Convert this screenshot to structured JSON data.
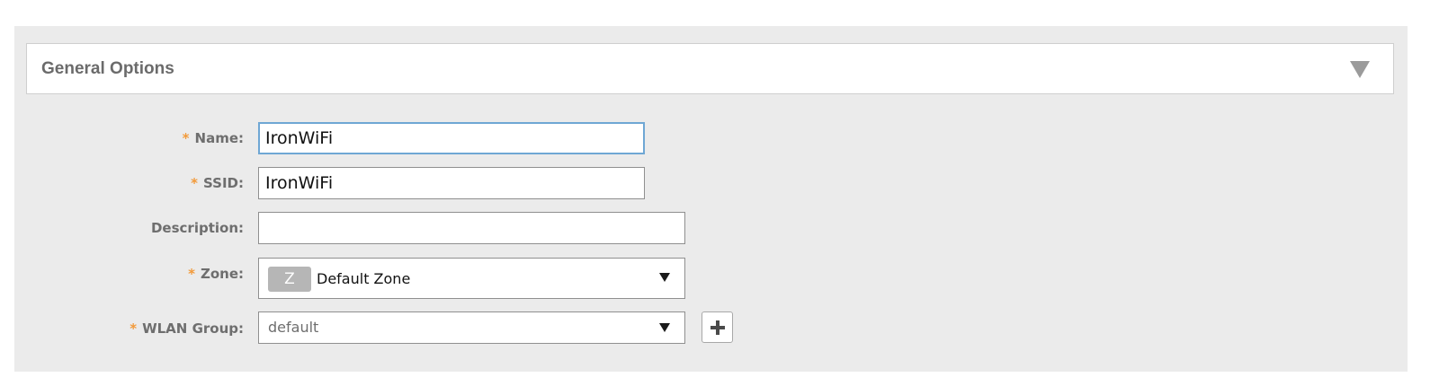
{
  "section": {
    "title": "General Options",
    "collapse_icon": "triangle-down-icon"
  },
  "form": {
    "required_marker": "*",
    "name": {
      "label": "Name:",
      "value": "IronWiFi",
      "required": true
    },
    "ssid": {
      "label": "SSID:",
      "value": "IronWiFi",
      "required": true
    },
    "description": {
      "label": "Description:",
      "value": "",
      "required": false
    },
    "zone": {
      "label": "Zone:",
      "badge": "Z",
      "value": "Default Zone",
      "required": true
    },
    "wlan_group": {
      "label": "WLAN Group:",
      "value": "default",
      "required": true,
      "add_icon": "plus-icon"
    }
  },
  "colors": {
    "panel_bg": "#ebebeb",
    "required_marker": "#f29a3a",
    "focus_border": "#6fa7d4",
    "label_text": "#6e6e6e"
  }
}
